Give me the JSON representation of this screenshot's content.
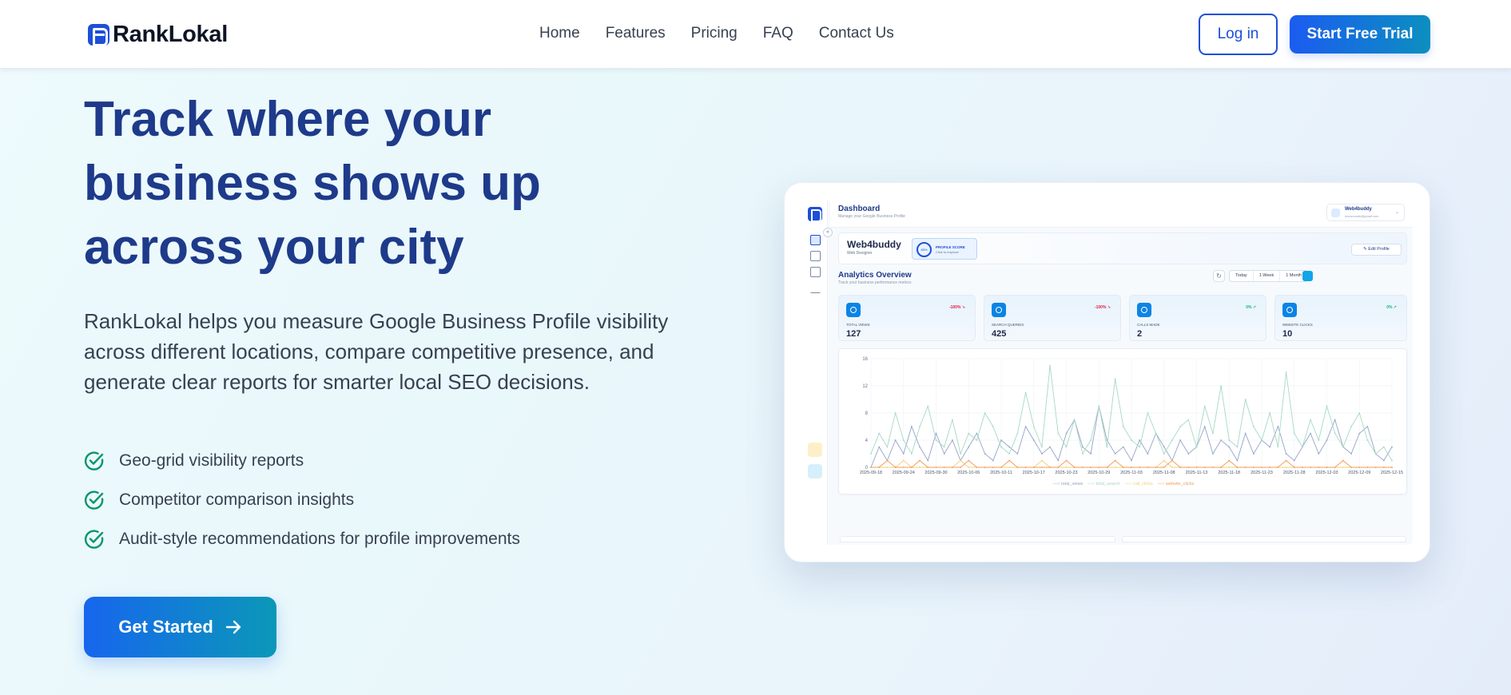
{
  "nav": {
    "brand": "RankLokal",
    "links": [
      "Home",
      "Features",
      "Pricing",
      "FAQ",
      "Contact Us"
    ],
    "login_label": "Log in",
    "trial_label": "Start Free Trial"
  },
  "hero": {
    "title": "Track where your business shows up across your city",
    "description": "RankLokal helps you measure Google Business Profile visibility across different locations, compare competitive presence, and generate clear reports for smarter local SEO decisions.",
    "features": [
      "Geo-grid visibility reports",
      "Competitor comparison insights",
      "Audit-style recommendations for profile improvements"
    ],
    "cta_label": "Get Started"
  },
  "colors": {
    "primary": "#1d4fd8",
    "heading": "#1e3a8a",
    "check": "#059669",
    "cta_gradient_start": "#1766ee",
    "cta_gradient_end": "#0b98b8"
  },
  "dashboard": {
    "title": "Dashboard",
    "subtitle": "Manage your Google Business Profile",
    "user_name": "Web4buddy",
    "user_email": "sinusmcafe@gmail.com",
    "profile_name": "Web4buddy",
    "profile_role": "Web Designer",
    "score_value": "85%",
    "score_label": "PROFILE SCORE",
    "score_hint": "Click to Improve",
    "edit_label": "Edit Profile",
    "analytics_title": "Analytics Overview",
    "analytics_subtitle": "Track your business performance metrics",
    "ranges": [
      "Today",
      "1 Week",
      "1 Month"
    ],
    "kpis": [
      {
        "label": "TOTAL VIEWS",
        "value": "127",
        "delta": "-100% ↘",
        "delta_color": "#e11d48"
      },
      {
        "label": "SEARCH QUERIES",
        "value": "425",
        "delta": "-100% ↘",
        "delta_color": "#e11d48"
      },
      {
        "label": "CALLS MADE",
        "value": "2",
        "delta": "0% ↗",
        "delta_color": "#10b981"
      },
      {
        "label": "WEBSITE CLICKS",
        "value": "10",
        "delta": "0% ↗",
        "delta_color": "#10b981"
      }
    ]
  },
  "chart_data": {
    "type": "line",
    "ylim": [
      0,
      16
    ],
    "yticks": [
      0,
      4,
      8,
      12,
      16
    ],
    "x_tick_labels": [
      "2025-09-18",
      "2025-09-24",
      "2025-09-30",
      "2025-10-06",
      "2025-10-11",
      "2025-10-17",
      "2025-10-23",
      "2025-10-29",
      "2025-11-03",
      "2025-11-08",
      "2025-11-13",
      "2025-11-18",
      "2025-11-23",
      "2025-11-28",
      "2025-12-03",
      "2025-12-09",
      "2025-12-15"
    ],
    "grid": true,
    "legend_position": "bottom",
    "series": [
      {
        "name": "total_views",
        "color": "#94a3c8",
        "values": [
          0,
          3,
          1,
          4,
          2,
          6,
          3,
          1,
          5,
          2,
          4,
          1,
          3,
          5,
          2,
          1,
          4,
          3,
          2,
          6,
          4,
          2,
          3,
          1,
          5,
          7,
          3,
          2,
          9,
          4,
          2,
          3,
          1,
          4,
          2,
          5,
          3,
          1,
          4,
          2,
          3,
          6,
          2,
          4,
          3,
          1,
          5,
          2,
          4,
          3,
          6,
          2,
          1,
          3,
          5,
          2,
          4,
          7,
          3,
          2,
          5,
          6,
          2,
          1,
          3
        ]
      },
      {
        "name": "total_search",
        "color": "#a7d8c4",
        "values": [
          2,
          5,
          3,
          8,
          4,
          2,
          6,
          9,
          4,
          3,
          7,
          2,
          5,
          4,
          8,
          6,
          3,
          2,
          5,
          11,
          6,
          3,
          15,
          5,
          3,
          7,
          2,
          4,
          9,
          3,
          13,
          6,
          4,
          3,
          8,
          5,
          2,
          4,
          6,
          7,
          3,
          9,
          5,
          12,
          4,
          3,
          10,
          6,
          4,
          8,
          3,
          14,
          5,
          3,
          7,
          4,
          9,
          5,
          3,
          6,
          8,
          4,
          2,
          3,
          1
        ]
      },
      {
        "name": "call_clicks",
        "color": "#f6d07a",
        "values": [
          0,
          0,
          0,
          0,
          1,
          0,
          0,
          0,
          0,
          0,
          0,
          1,
          0,
          0,
          0,
          0,
          0,
          0,
          0,
          0,
          0,
          1,
          0,
          0,
          0,
          0,
          0,
          0,
          0,
          0,
          0,
          0,
          0,
          0,
          0,
          0,
          1,
          0,
          0,
          0,
          0,
          0,
          0,
          0,
          0,
          0,
          0,
          0,
          0,
          0,
          0,
          0,
          0,
          0,
          0,
          0,
          0,
          0,
          0,
          0,
          0,
          0,
          0,
          0,
          0
        ]
      },
      {
        "name": "website_clicks",
        "color": "#f29c5a",
        "values": [
          0,
          0,
          1,
          0,
          0,
          0,
          1,
          0,
          0,
          0,
          0,
          0,
          1,
          0,
          0,
          0,
          0,
          1,
          0,
          0,
          0,
          0,
          0,
          0,
          1,
          0,
          0,
          0,
          0,
          0,
          1,
          0,
          0,
          0,
          0,
          0,
          0,
          1,
          0,
          0,
          0,
          0,
          0,
          0,
          1,
          0,
          0,
          0,
          0,
          0,
          0,
          1,
          0,
          0,
          0,
          0,
          0,
          0,
          1,
          0,
          0,
          0,
          0,
          0,
          0
        ]
      }
    ]
  }
}
